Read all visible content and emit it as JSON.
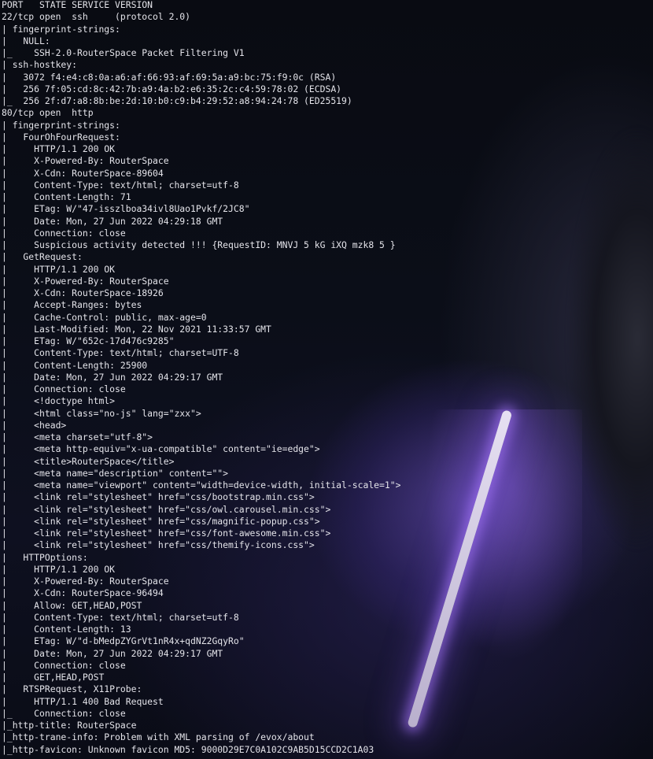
{
  "terminal": {
    "lines": [
      "PORT   STATE SERVICE VERSION",
      "22/tcp open  ssh     (protocol 2.0)",
      "| fingerprint-strings:",
      "|   NULL:",
      "|_    SSH-2.0-RouterSpace Packet Filtering V1",
      "| ssh-hostkey:",
      "|   3072 f4:e4:c8:0a:a6:af:66:93:af:69:5a:a9:bc:75:f9:0c (RSA)",
      "|   256 7f:05:cd:8c:42:7b:a9:4a:b2:e6:35:2c:c4:59:78:02 (ECDSA)",
      "|_  256 2f:d7:a8:8b:be:2d:10:b0:c9:b4:29:52:a8:94:24:78 (ED25519)",
      "80/tcp open  http",
      "| fingerprint-strings:",
      "|   FourOhFourRequest:",
      "|     HTTP/1.1 200 OK",
      "|     X-Powered-By: RouterSpace",
      "|     X-Cdn: RouterSpace-89604",
      "|     Content-Type: text/html; charset=utf-8",
      "|     Content-Length: 71",
      "|     ETag: W/\"47-isszlboa34ivl8Uao1Pvkf/2JC8\"",
      "|     Date: Mon, 27 Jun 2022 04:29:18 GMT",
      "|     Connection: close",
      "|     Suspicious activity detected !!! {RequestID: MNVJ 5 kG iXQ mzk8 5 }",
      "|   GetRequest:",
      "|     HTTP/1.1 200 OK",
      "|     X-Powered-By: RouterSpace",
      "|     X-Cdn: RouterSpace-18926",
      "|     Accept-Ranges: bytes",
      "|     Cache-Control: public, max-age=0",
      "|     Last-Modified: Mon, 22 Nov 2021 11:33:57 GMT",
      "|     ETag: W/\"652c-17d476c9285\"",
      "|     Content-Type: text/html; charset=UTF-8",
      "|     Content-Length: 25900",
      "|     Date: Mon, 27 Jun 2022 04:29:17 GMT",
      "|     Connection: close",
      "|     <!doctype html>",
      "|     <html class=\"no-js\" lang=\"zxx\">",
      "|     <head>",
      "|     <meta charset=\"utf-8\">",
      "|     <meta http-equiv=\"x-ua-compatible\" content=\"ie=edge\">",
      "|     <title>RouterSpace</title>",
      "|     <meta name=\"description\" content=\"\">",
      "|     <meta name=\"viewport\" content=\"width=device-width, initial-scale=1\">",
      "|     <link rel=\"stylesheet\" href=\"css/bootstrap.min.css\">",
      "|     <link rel=\"stylesheet\" href=\"css/owl.carousel.min.css\">",
      "|     <link rel=\"stylesheet\" href=\"css/magnific-popup.css\">",
      "|     <link rel=\"stylesheet\" href=\"css/font-awesome.min.css\">",
      "|     <link rel=\"stylesheet\" href=\"css/themify-icons.css\">",
      "|   HTTPOptions:",
      "|     HTTP/1.1 200 OK",
      "|     X-Powered-By: RouterSpace",
      "|     X-Cdn: RouterSpace-96494",
      "|     Allow: GET,HEAD,POST",
      "|     Content-Type: text/html; charset=utf-8",
      "|     Content-Length: 13",
      "|     ETag: W/\"d-bMedpZYGrVt1nR4x+qdNZ2GqyRo\"",
      "|     Date: Mon, 27 Jun 2022 04:29:17 GMT",
      "|     Connection: close",
      "|     GET,HEAD,POST",
      "|   RTSPRequest, X11Probe:",
      "|     HTTP/1.1 400 Bad Request",
      "|_    Connection: close",
      "|_http-title: RouterSpace",
      "|_http-trane-info: Problem with XML parsing of /evox/about",
      "|_http-favicon: Unknown favicon MD5: 9000D29E7C0A102C9AB5D15CCD2C1A03"
    ]
  }
}
